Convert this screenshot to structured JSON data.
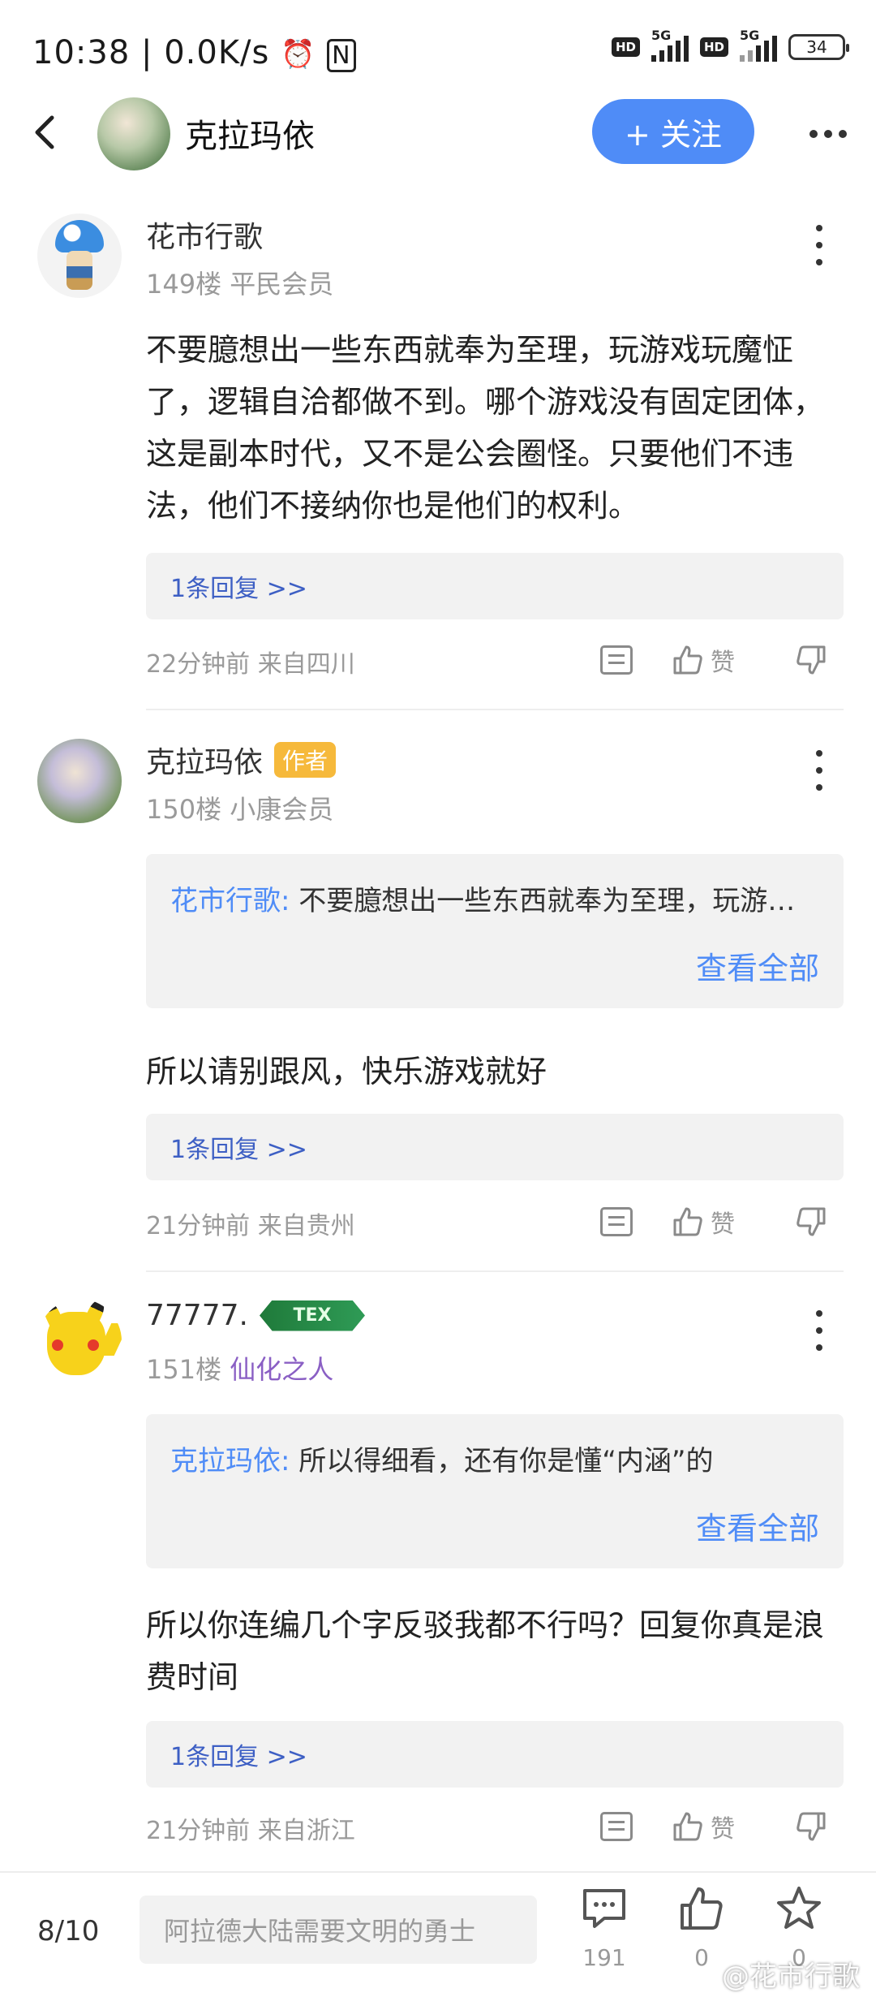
{
  "status_bar": {
    "time": "10:38",
    "net_speed": "0.0K/s",
    "sim1_net": "5G",
    "sim2_net": "5G",
    "hd": "HD",
    "battery": "34"
  },
  "header": {
    "title": "克拉玛依",
    "follow_label": "+ 关注"
  },
  "comments": [
    {
      "username": "花市行歌",
      "floor": "149楼",
      "rank": "平民会员",
      "text": "不要臆想出一些东西就奉为至理，玩游戏玩魔怔了，逻辑自洽都做不到。哪个游戏没有固定团体，这是副本时代，又不是公会圈怪。只要他们不违法，他们不接纳你也是他们的权利。",
      "reply_link": "1条回复 >>",
      "time_location": "22分钟前 来自四川",
      "like_label": "赞"
    },
    {
      "username": "克拉玛依",
      "author_badge": "作者",
      "floor": "150楼",
      "rank": "小康会员",
      "quote_name": "花市行歌:",
      "quote_text": " 不要臆想出一些东西就奉为至理，玩游…",
      "view_all": "查看全部",
      "text": "所以请别跟风，快乐游戏就好",
      "reply_link": "1条回复 >>",
      "time_location": "21分钟前 来自贵州",
      "like_label": "赞"
    },
    {
      "username": "77777.",
      "level_badge": "TEX",
      "floor": "151楼",
      "rank": "仙化之人",
      "quote_name": "克拉玛依:",
      "quote_text": " 所以得细看，还有你是懂“内涵”的",
      "view_all": "查看全部",
      "text": "所以你连编几个字反驳我都不行吗？回复你真是浪费时间",
      "reply_link": "1条回复 >>",
      "time_location": "21分钟前 来自浙江",
      "like_label": "赞"
    }
  ],
  "bottom_bar": {
    "page": "8/10",
    "input_placeholder": "阿拉德大陆需要文明的勇士",
    "comment_count": "191",
    "like_count": "0",
    "fav_count": "0",
    "watermark": "@花市行歌"
  },
  "colors": {
    "accent_blue": "#4f8cf7",
    "author_badge": "#f6b93b",
    "rank_purple": "#8a5fc4",
    "reply_link": "#3d5fc4"
  }
}
